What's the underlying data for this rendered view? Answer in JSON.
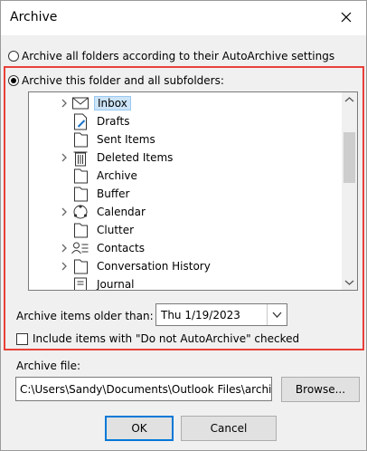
{
  "window": {
    "title": "Archive"
  },
  "options": {
    "archive_all_label": "Archive all folders according to their AutoArchive settings",
    "archive_this_label": "Archive this folder and all subfolders:"
  },
  "folders": [
    {
      "label": "Inbox",
      "icon": "inbox-icon",
      "expandable": true,
      "selected": true
    },
    {
      "label": "Drafts",
      "icon": "drafts-icon",
      "expandable": false
    },
    {
      "label": "Sent Items",
      "icon": "folder-icon",
      "expandable": false
    },
    {
      "label": "Deleted Items",
      "icon": "trash-icon",
      "expandable": true
    },
    {
      "label": "Archive",
      "icon": "folder-icon",
      "expandable": false
    },
    {
      "label": "Buffer",
      "icon": "folder-icon",
      "expandable": false
    },
    {
      "label": "Calendar",
      "icon": "calendar-icon",
      "expandable": true
    },
    {
      "label": "Clutter",
      "icon": "folder-icon",
      "expandable": false
    },
    {
      "label": "Contacts",
      "icon": "contacts-icon",
      "expandable": true
    },
    {
      "label": "Conversation History",
      "icon": "folder-icon",
      "expandable": true
    },
    {
      "label": "Journal",
      "icon": "journal-icon",
      "expandable": false
    }
  ],
  "older_than": {
    "label": "Archive items older than:",
    "value": "Thu 1/19/2023"
  },
  "include": {
    "label": "Include items with \"Do not AutoArchive\" checked",
    "checked": false
  },
  "archive_file": {
    "label": "Archive file:",
    "value": "C:\\Users\\Sandy\\Documents\\Outlook Files\\archiv",
    "browse_label": "Browse..."
  },
  "buttons": {
    "ok": "OK",
    "cancel": "Cancel"
  },
  "colors": {
    "highlight": "#e8403a",
    "selection": "#cce4f7",
    "default_border": "#0078d7"
  }
}
